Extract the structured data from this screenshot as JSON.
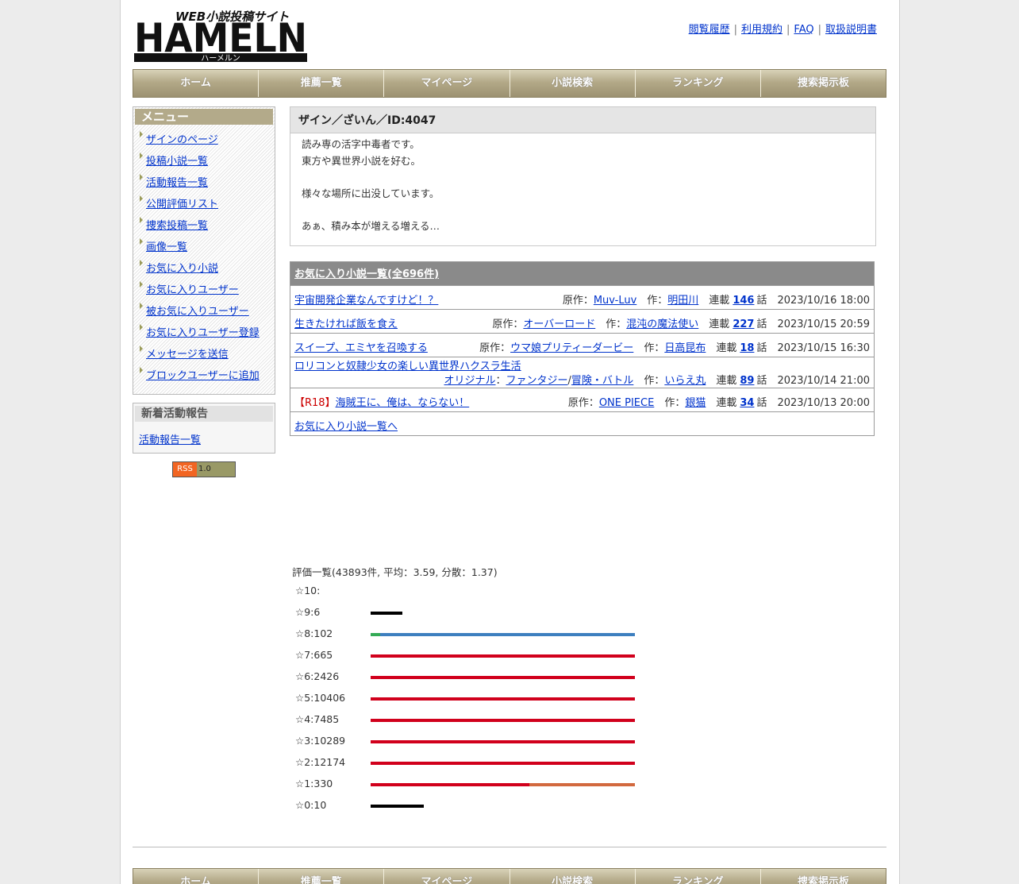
{
  "header": {
    "logo": {
      "top_text": "WEB小説投稿サイト",
      "main_text": "HAMELN",
      "sub_text": "ハーメルン"
    },
    "top_links": [
      "閲覧履歴",
      "利用規約",
      "FAQ",
      "取扱説明書"
    ]
  },
  "nav": [
    "ホーム",
    "推薦一覧",
    "マイページ",
    "小説検索",
    "ランキング",
    "捜索掲示板"
  ],
  "sidebar": {
    "menu_title": "メニュー",
    "items": [
      "ザインのページ",
      "投稿小説一覧",
      "活動報告一覧",
      "公開評価リスト",
      "捜索投稿一覧",
      "画像一覧",
      "お気に入り小説",
      "お気に入りユーザー",
      "被お気に入りユーザー",
      "お気に入りユーザー登録",
      "メッセージを送信",
      "ブロックユーザーに追加"
    ],
    "news_title": "新着活動報告",
    "news_link": "活動報告一覧",
    "rss": {
      "left": "RSS",
      "right": "1.0"
    }
  },
  "profile": {
    "title": "ザイン／ざいん／ID:4047",
    "lines": [
      "読み専の活字中毒者です。",
      "東方や異世界小説を好む。",
      "",
      "様々な場所に出没しています。",
      "",
      "あぁ、積み本が増える増える…"
    ]
  },
  "favorites": {
    "header": "お気に入り小説一覧(全696件)",
    "rows": [
      {
        "prefix": "",
        "title": "宇宙開発企業なんですけど！？",
        "source_label": "原作：",
        "source": "Muv-Luv",
        "author_label": "作：",
        "author": "明田川",
        "ep_label": "連載",
        "episodes": "146",
        "ep_suffix": "話",
        "date": "2023/10/16 18:00"
      },
      {
        "prefix": "",
        "title": "生きたければ飯を食え",
        "source_label": "原作：",
        "source": "オーバーロード",
        "author_label": "作：",
        "author": "混沌の魔法使い",
        "ep_label": "連載",
        "episodes": "227",
        "ep_suffix": "話",
        "date": "2023/10/15 20:59"
      },
      {
        "prefix": "",
        "title": "スイープ、エミヤを召喚する",
        "source_label": "原作：",
        "source": "ウマ娘プリティーダービー",
        "author_label": "作：",
        "author": "日高昆布",
        "ep_label": "連載",
        "episodes": "18",
        "ep_suffix": "話",
        "date": "2023/10/15 16:30"
      },
      {
        "prefix": "",
        "title": "ロリコンと奴隷少女の楽しい異世界ハクスラ生活",
        "source_label": "",
        "source": "オリジナル",
        "genre_sep": "：",
        "genre1": "ファンタジー",
        "genre_slash": "/",
        "genre2": "冒険・バトル",
        "author_label": "作：",
        "author": "いらえ丸",
        "ep_label": "連載",
        "episodes": "89",
        "ep_suffix": "話",
        "date": "2023/10/14 21:00"
      },
      {
        "prefix": "【R18】",
        "title": "海賊王に、俺は、ならない！",
        "source_label": "原作：",
        "source": "ONE PIECE",
        "author_label": "作：",
        "author": "銀猫",
        "ep_label": "連載",
        "episodes": "34",
        "ep_suffix": "話",
        "date": "2023/10/13 20:00"
      }
    ],
    "footer_link": "お気に入り小説一覧へ"
  },
  "ratings": {
    "summary": "評価一覧(43893件, 平均：3.59, 分散：1.37)",
    "rows": [
      {
        "label": "☆10:",
        "bar_fraction": 0,
        "segments": []
      },
      {
        "label": "☆9:6",
        "bar_fraction": 0.12,
        "segments": [
          {
            "color": "#000000",
            "fraction": 1
          }
        ]
      },
      {
        "label": "☆8:102",
        "bar_fraction": 1,
        "segments": [
          {
            "color": "#33aa55",
            "fraction": 0.035
          },
          {
            "color": "#3d7fbf",
            "fraction": 0.965
          }
        ]
      },
      {
        "label": "☆7:665",
        "bar_fraction": 1,
        "segments": [
          {
            "color": "#d1001c",
            "fraction": 1
          }
        ]
      },
      {
        "label": "☆6:2426",
        "bar_fraction": 1,
        "segments": [
          {
            "color": "#d1001c",
            "fraction": 1
          }
        ]
      },
      {
        "label": "☆5:10406",
        "bar_fraction": 1,
        "segments": [
          {
            "color": "#d1001c",
            "fraction": 1
          }
        ]
      },
      {
        "label": "☆4:7485",
        "bar_fraction": 1,
        "segments": [
          {
            "color": "#d1001c",
            "fraction": 1
          }
        ]
      },
      {
        "label": "☆3:10289",
        "bar_fraction": 1,
        "segments": [
          {
            "color": "#d1001c",
            "fraction": 1
          }
        ]
      },
      {
        "label": "☆2:12174",
        "bar_fraction": 1,
        "segments": [
          {
            "color": "#d1001c",
            "fraction": 1
          }
        ]
      },
      {
        "label": "☆1:330",
        "bar_fraction": 1,
        "segments": [
          {
            "color": "#d1001c",
            "fraction": 0.6
          },
          {
            "color": "#d2693e",
            "fraction": 0.4
          }
        ]
      },
      {
        "label": "☆0:10",
        "bar_fraction": 0.2,
        "segments": [
          {
            "color": "#000000",
            "fraction": 1
          }
        ]
      }
    ]
  }
}
